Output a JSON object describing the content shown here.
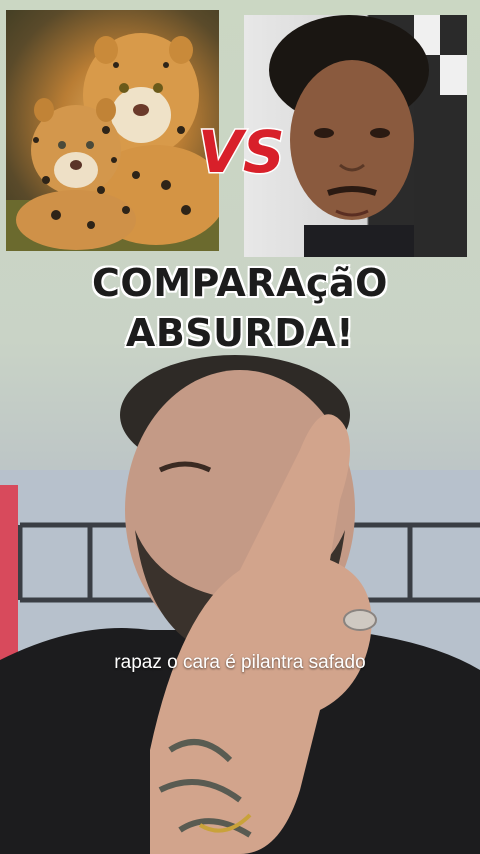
{
  "comparison": {
    "left_image": "jaguar-with-cub",
    "right_image": "man-portrait",
    "vs_label": "VS"
  },
  "headline": {
    "line1": "COMPARAçãO",
    "line2": "ABSURDA!"
  },
  "caption": "rapaz o cara é pilantra safado",
  "colors": {
    "vs_red": "#d8202a",
    "headline_text": "#1c1c1c",
    "caption_text": "#ffffff"
  }
}
